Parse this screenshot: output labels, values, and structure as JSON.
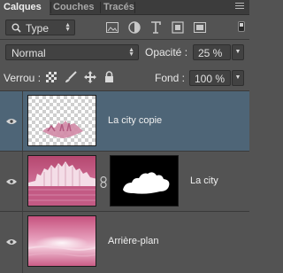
{
  "tabs": [
    "Calques",
    "Couches",
    "Tracés"
  ],
  "filter": {
    "selected": "Type"
  },
  "blend": {
    "mode": "Normal",
    "opacity_label": "Opacité :",
    "opacity_value": "25 %"
  },
  "lock": {
    "label": "Verrou :",
    "fill_label": "Fond :",
    "fill_value": "100 %"
  },
  "layers": [
    {
      "name": "La city copie",
      "selected": true,
      "visible": true,
      "has_mask": false
    },
    {
      "name": "La city",
      "selected": false,
      "visible": true,
      "has_mask": true
    },
    {
      "name": "Arrière-plan",
      "selected": false,
      "visible": true,
      "has_mask": false
    }
  ],
  "colors": {
    "panel": "#535353",
    "selected": "#4e6577",
    "tabbar": "#3c3c3c",
    "pink": "#c2557f"
  },
  "icons": [
    "filter-image-icon",
    "filter-adjustment-icon",
    "filter-type-icon",
    "filter-shape-icon",
    "filter-smart-object-icon",
    "lock-transparency-icon",
    "lock-paint-icon",
    "lock-move-icon",
    "lock-all-icon",
    "visibility-eye-icon",
    "chain-link-icon",
    "panel-menu-icon"
  ]
}
